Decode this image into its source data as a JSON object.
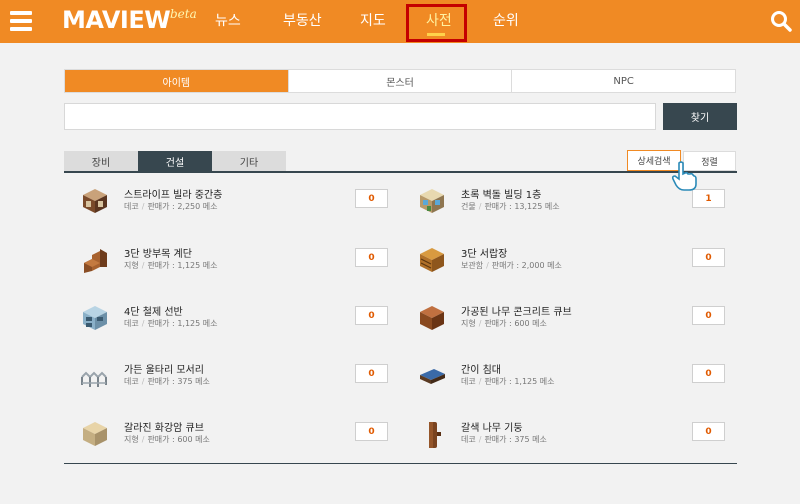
{
  "header": {
    "logo": "MAVIEW",
    "logo_badge": "beta",
    "nav": [
      {
        "label": "뉴스"
      },
      {
        "label": "부동산"
      },
      {
        "label": "지도"
      },
      {
        "label": "사전"
      },
      {
        "label": "순위"
      }
    ],
    "active_nav": "사전",
    "colors": {
      "brand": "#f08a24",
      "dark": "#37474f",
      "highlight": "#c40000"
    }
  },
  "main_tabs": [
    {
      "label": "아이템",
      "active": true
    },
    {
      "label": "몬스터",
      "active": false
    },
    {
      "label": "NPC",
      "active": false
    }
  ],
  "search": {
    "value": "",
    "placeholder": "",
    "button_label": "찾기"
  },
  "sub_tabs": [
    {
      "label": "장비",
      "active": false
    },
    {
      "label": "건설",
      "active": true
    },
    {
      "label": "기타",
      "active": false
    }
  ],
  "actions": {
    "detail_search": "상세검색",
    "sort": "정렬"
  },
  "price_label": "판매가 :",
  "items": [
    {
      "name": "스트라이프 빌라 중간층",
      "category": "데코",
      "price": "2,250 메소",
      "count": "0",
      "icon": "striped-villa-icon"
    },
    {
      "name": "초록 벽돌 빌딩 1층",
      "category": "건물",
      "price": "13,125 메소",
      "count": "1",
      "icon": "green-brick-building-icon"
    },
    {
      "name": "3단 방부목 계단",
      "category": "지형",
      "price": "1,125 메소",
      "count": "0",
      "icon": "wood-stairs-icon"
    },
    {
      "name": "3단 서랍장",
      "category": "보관함",
      "price": "2,000 메소",
      "count": "0",
      "icon": "drawer-chest-icon"
    },
    {
      "name": "4단 철제 선반",
      "category": "데코",
      "price": "1,125 메소",
      "count": "0",
      "icon": "steel-shelf-icon"
    },
    {
      "name": "가공된 나무 콘크리트 큐브",
      "category": "지형",
      "price": "600 메소",
      "count": "0",
      "icon": "wood-concrete-cube-icon"
    },
    {
      "name": "가든 울타리 모서리",
      "category": "데코",
      "price": "375 메소",
      "count": "0",
      "icon": "garden-fence-corner-icon"
    },
    {
      "name": "간이 침대",
      "category": "데코",
      "price": "1,125 메소",
      "count": "0",
      "icon": "simple-bed-icon"
    },
    {
      "name": "갈라진 화강암 큐브",
      "category": "지형",
      "price": "600 메소",
      "count": "0",
      "icon": "cracked-granite-cube-icon"
    },
    {
      "name": "갈색 나무 기둥",
      "category": "데코",
      "price": "375 메소",
      "count": "0",
      "icon": "brown-wood-pillar-icon"
    }
  ]
}
